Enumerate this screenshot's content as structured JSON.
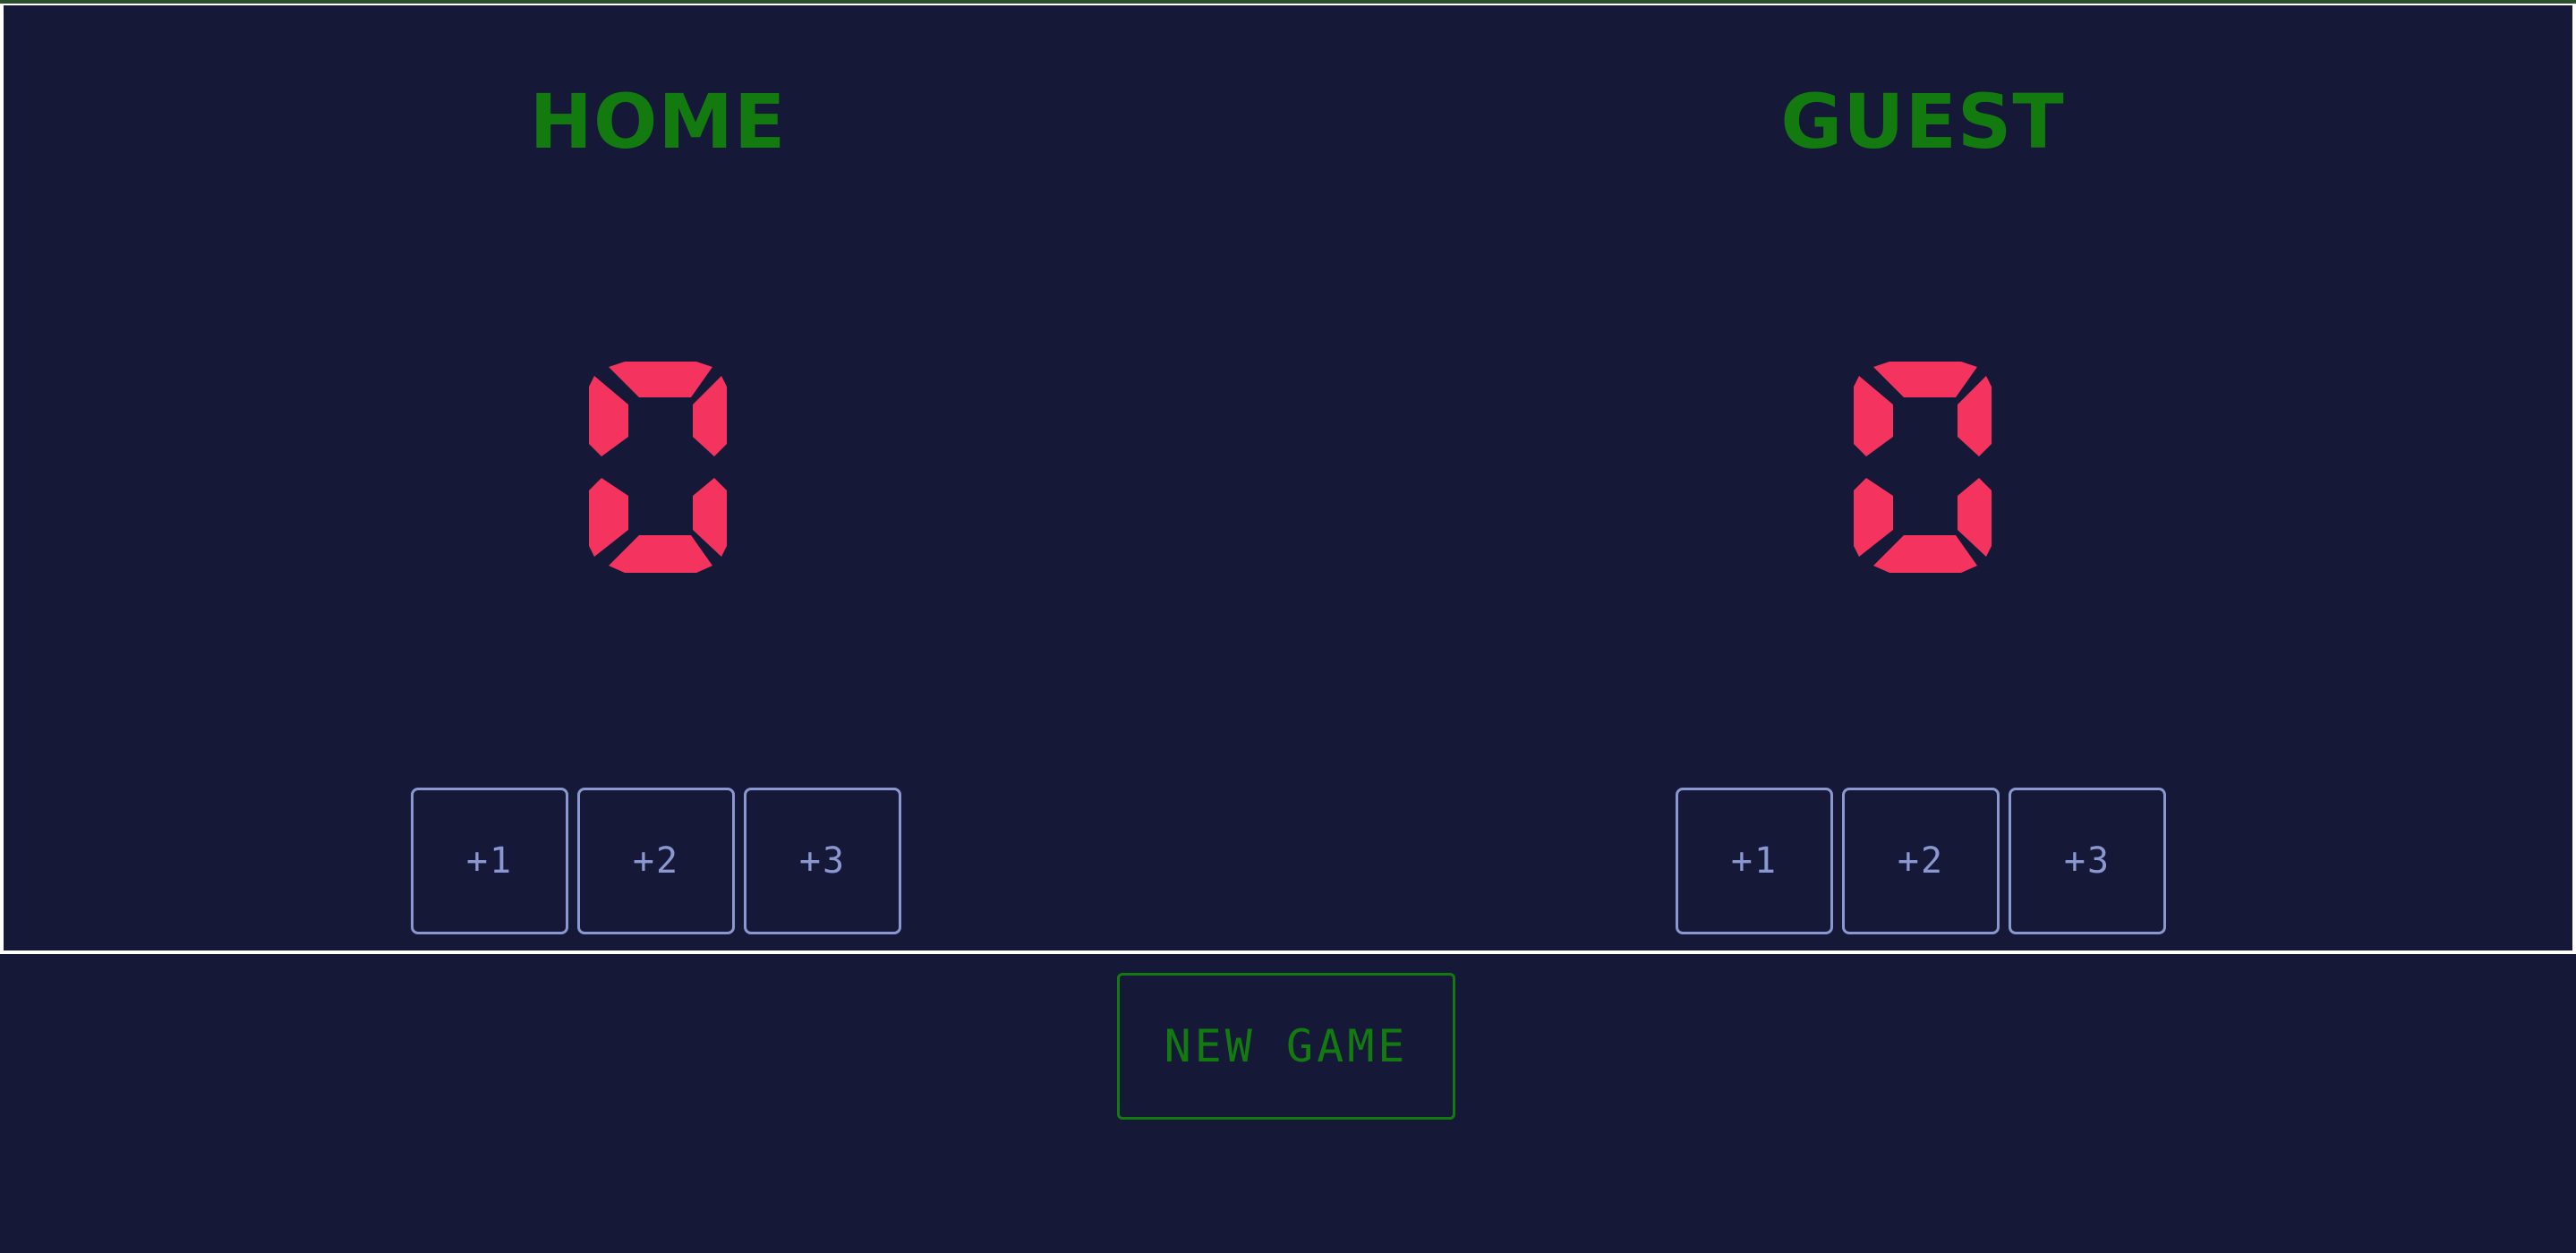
{
  "home": {
    "title": "HOME",
    "score": "0",
    "buttons": [
      {
        "label": "+1"
      },
      {
        "label": "+2"
      },
      {
        "label": "+3"
      }
    ]
  },
  "guest": {
    "title": "GUEST",
    "score": "0",
    "buttons": [
      {
        "label": "+1"
      },
      {
        "label": "+2"
      },
      {
        "label": "+3"
      }
    ]
  },
  "controls": {
    "new_game_label": "NEW GAME"
  },
  "colors": {
    "background": "#151937",
    "title": "#137a10",
    "score_digit": "#f4345e",
    "button_border": "#8a97d0",
    "board_border": "#ffffff"
  }
}
